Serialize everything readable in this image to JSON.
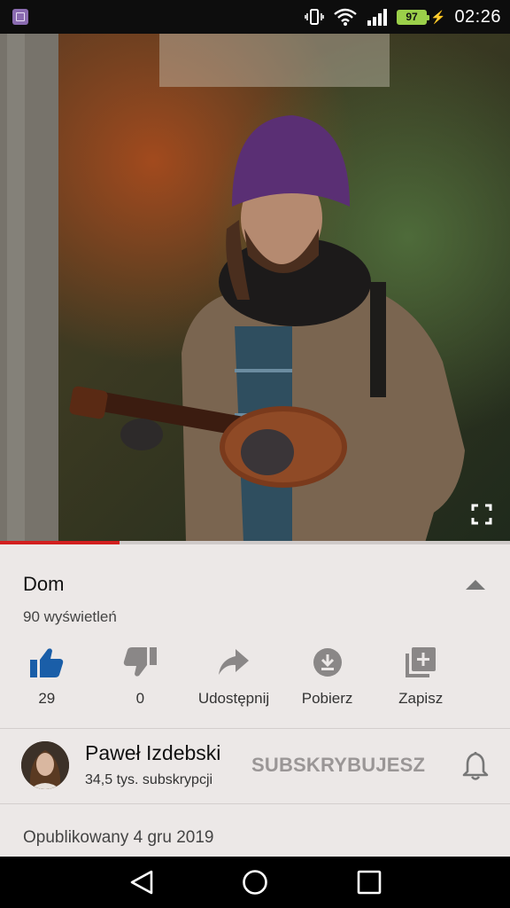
{
  "status_bar": {
    "battery": "97",
    "time": "02:26",
    "icons": [
      "gallery-notification-icon",
      "vibrate-icon",
      "wifi-icon",
      "signal-icon",
      "battery-icon",
      "charging-icon"
    ]
  },
  "player": {
    "progress": 0.235,
    "progress_color": "#d21f1f",
    "icons": [
      "fullscreen-icon"
    ]
  },
  "video": {
    "title": "Dom",
    "views": "90 wyświetleń"
  },
  "actions": [
    {
      "name": "like",
      "icon": "thumbs-up-icon",
      "label": "29",
      "color": "#1a5ea8"
    },
    {
      "name": "dislike",
      "icon": "thumbs-down-icon",
      "label": "0"
    },
    {
      "name": "share",
      "icon": "share-icon",
      "label": "Udostępnij"
    },
    {
      "name": "download",
      "icon": "download-icon",
      "label": "Pobierz"
    },
    {
      "name": "save",
      "icon": "add-to-playlist-icon",
      "label": "Zapisz"
    }
  ],
  "channel": {
    "name": "Paweł Izdebski",
    "subscribers": "34,5 tys. subskrypcji",
    "subscribe_label": "SUBSKRYBUJESZ"
  },
  "published": "Opublikowany 4 gru 2019",
  "nav": {
    "icons": [
      "back-icon",
      "home-icon",
      "recents-icon"
    ]
  }
}
